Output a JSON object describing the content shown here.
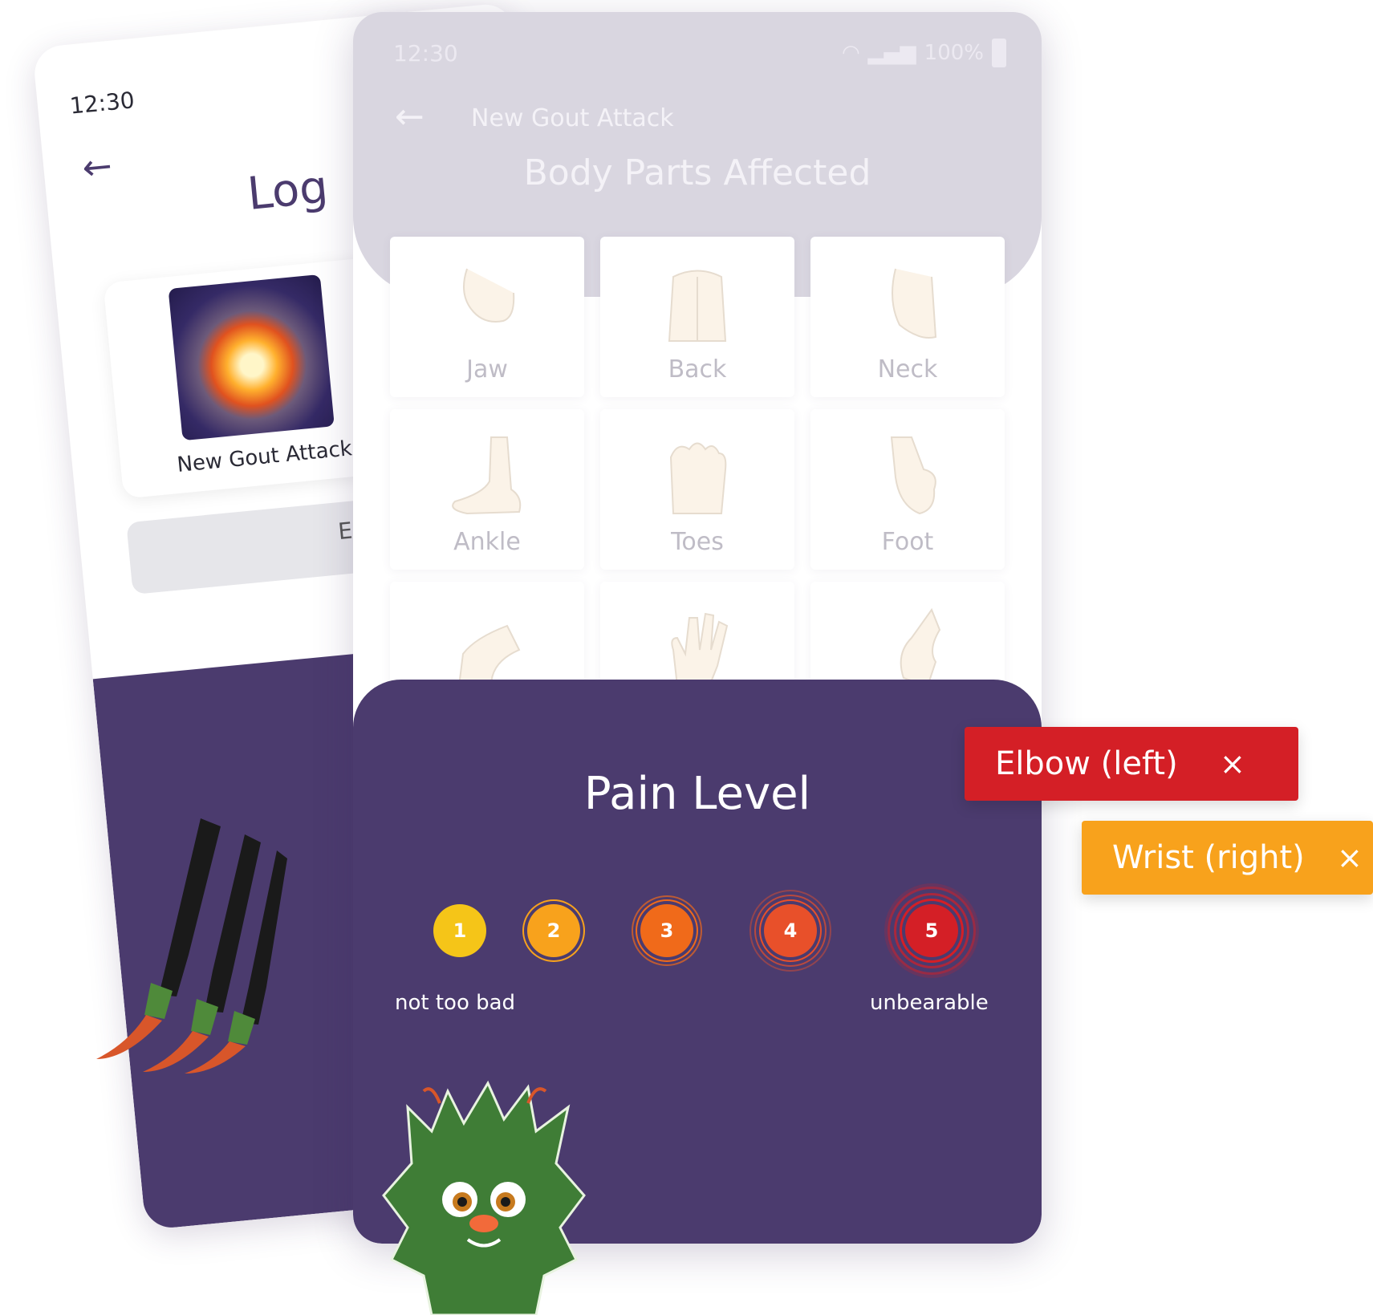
{
  "back_screen": {
    "status_time": "12:30",
    "title": "Log",
    "card_label": "New Gout Attack",
    "button_label": "E"
  },
  "front_screen": {
    "status_time": "12:30",
    "battery_text": "100%",
    "nav_title": "New Gout Attack",
    "section_title": "Body Parts Affected",
    "body_parts": [
      {
        "label": "Jaw",
        "icon": "jaw-icon"
      },
      {
        "label": "Back",
        "icon": "back-icon"
      },
      {
        "label": "Neck",
        "icon": "neck-icon"
      },
      {
        "label": "Ankle",
        "icon": "ankle-icon"
      },
      {
        "label": "Toes",
        "icon": "toes-icon"
      },
      {
        "label": "Foot",
        "icon": "foot-icon"
      },
      {
        "label": "",
        "icon": "elbow-icon"
      },
      {
        "label": "",
        "icon": "hand-icon"
      },
      {
        "label": "",
        "icon": "knee-icon"
      }
    ],
    "pain": {
      "title": "Pain Level",
      "levels": [
        {
          "value": "1",
          "color": "#f5c518"
        },
        {
          "value": "2",
          "color": "#f8a21c"
        },
        {
          "value": "3",
          "color": "#f06a1a"
        },
        {
          "value": "4",
          "color": "#e8502a"
        },
        {
          "value": "5",
          "color": "#d41f26"
        }
      ],
      "min_label": "not too bad",
      "max_label": "unbearable"
    }
  },
  "chips": [
    {
      "label": "Elbow (left)",
      "close": "×",
      "color": "#d41f26"
    },
    {
      "label": "Wrist (right)",
      "close": "×",
      "color": "#f8a21c"
    }
  ]
}
